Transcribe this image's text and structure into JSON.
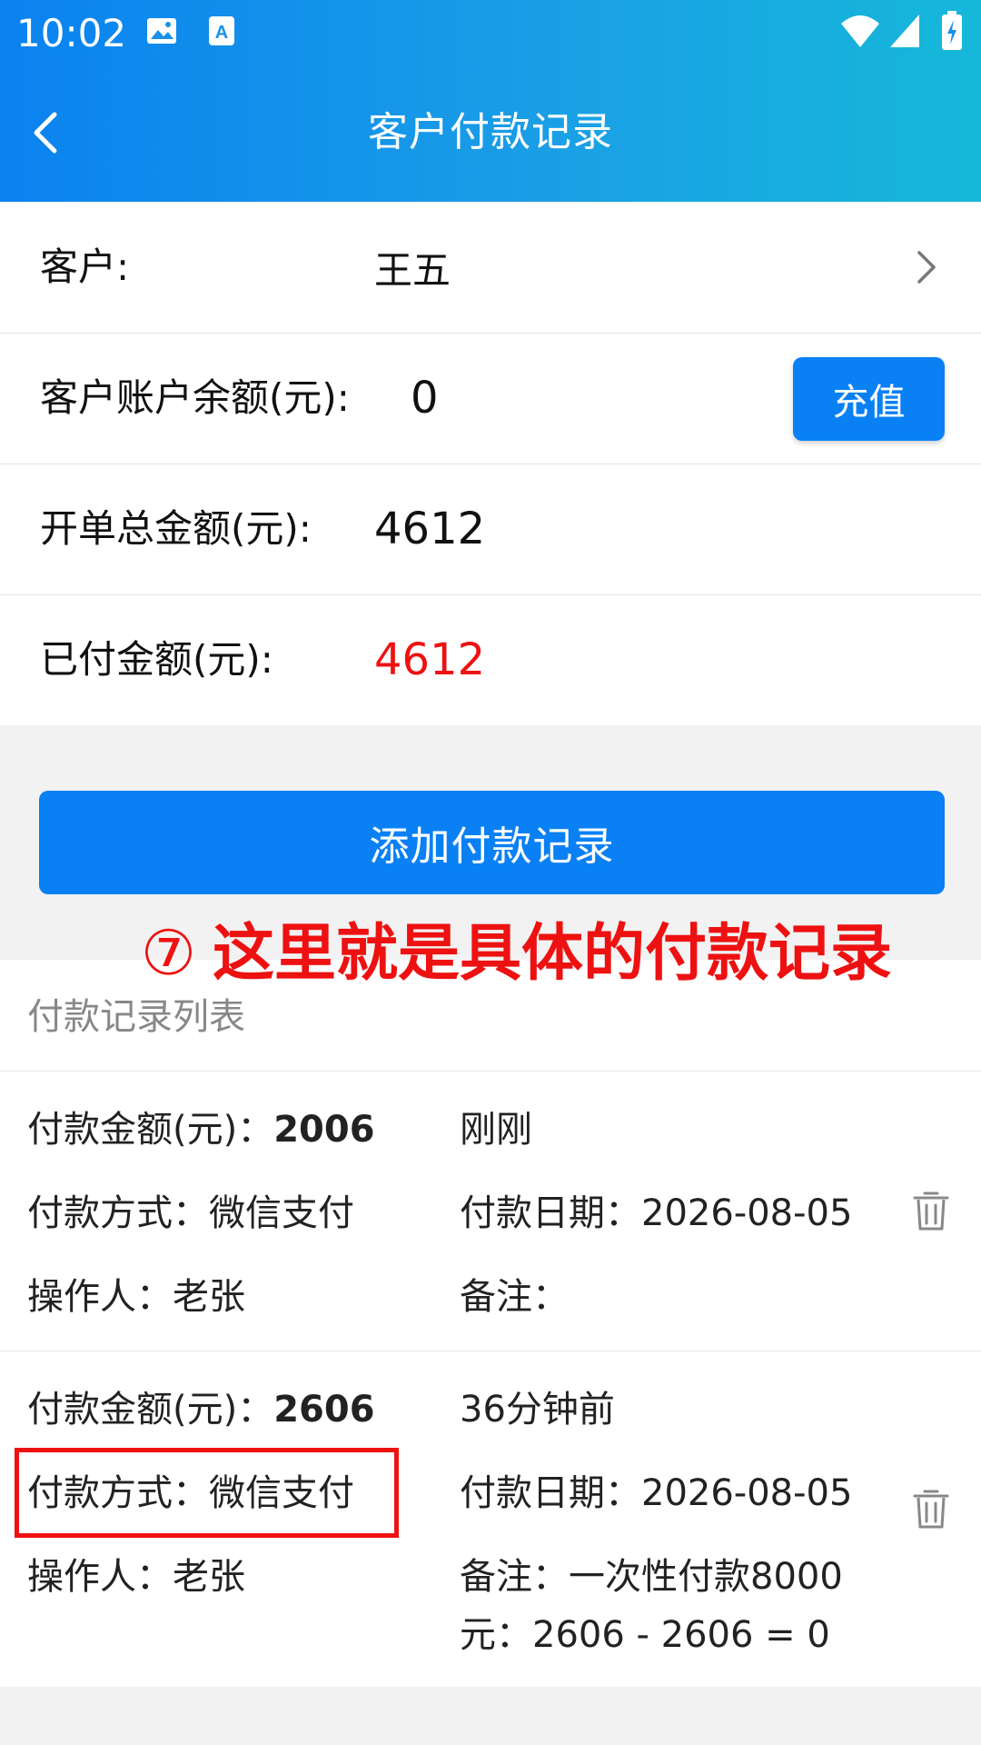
{
  "status_bar": {
    "time": "10:02"
  },
  "nav": {
    "title": "客户付款记录"
  },
  "info": {
    "customer_label": "客户:",
    "customer_value": "王五",
    "balance_label": "客户账户余额(元):",
    "balance_value": "0",
    "recharge_label": "充值",
    "total_label": "开单总金额(元):",
    "total_value": "4612",
    "paid_label": "已付金额(元):",
    "paid_value": "4612"
  },
  "add_button": "添加付款记录",
  "annotation": {
    "num": "⑦",
    "text": "这里就是具体的付款记录"
  },
  "list": {
    "title": "付款记录列表",
    "records": [
      {
        "amount_label": "付款金额(元)：",
        "amount": "2006",
        "time": "刚刚",
        "method": "付款方式：微信支付",
        "date": "付款日期：2026-08-05",
        "operator": "操作人：老张",
        "note_line1": "备注：",
        "note_line2": ""
      },
      {
        "amount_label": "付款金额(元)：",
        "amount": "2606",
        "time": "36分钟前",
        "method": "付款方式：微信支付",
        "date": "付款日期：2026-08-05",
        "operator": "操作人：老张",
        "note_line1": "备注：一次性付款8000",
        "note_line2": "元：2606 - 2606 = 0"
      }
    ]
  },
  "colors": {
    "accent": "#0a80f5",
    "paid": "#ee1111",
    "annotation": "#ee1111"
  }
}
